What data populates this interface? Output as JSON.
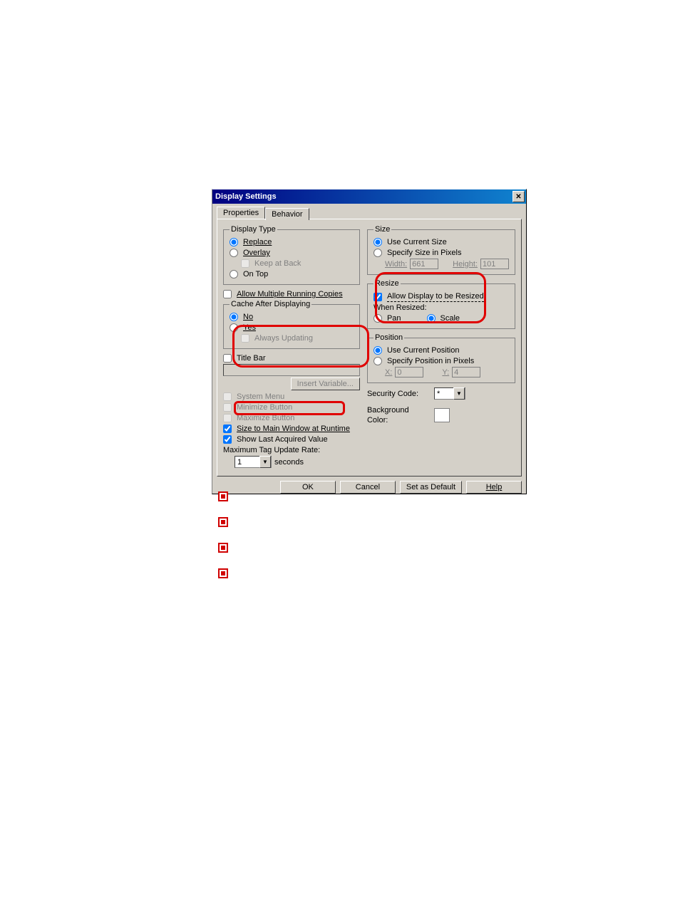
{
  "dialog": {
    "title": "Display Settings",
    "tabs": {
      "properties": "Properties",
      "behavior": "Behavior"
    },
    "left": {
      "display_type": {
        "legend": "Display Type",
        "replace": "Replace",
        "overlay": "Overlay",
        "keep_at_back": "Keep at Back",
        "on_top": "On Top"
      },
      "allow_multiple": "Allow Multiple Running Copies",
      "cache": {
        "legend": "Cache After Displaying",
        "no": "No",
        "yes": "Yes",
        "always_updating": "Always Updating"
      },
      "titlebar": {
        "label": "Title Bar",
        "value": "",
        "insert_variable": "Insert Variable..."
      },
      "system_menu": "System Menu",
      "minimize_button": "Minimize Button",
      "maximize_button": "Maximize Button",
      "size_to_main": "Size to Main Window at Runtime",
      "show_last_acquired": "Show Last Acquired Value",
      "max_tag_update": "Maximum Tag Update Rate:",
      "rate_value": "1",
      "rate_unit": "seconds"
    },
    "right": {
      "size": {
        "legend": "Size",
        "use_current": "Use Current Size",
        "specify": "Specify Size in Pixels",
        "width_label": "Width:",
        "width_value": "661",
        "height_label": "Height:",
        "height_value": "101"
      },
      "resize": {
        "legend": "Resize",
        "allow": "Allow Display to be Resized",
        "when": "When Resized:",
        "pan": "Pan",
        "scale": "Scale"
      },
      "position": {
        "legend": "Position",
        "use_current": "Use Current Position",
        "specify": "Specify Position in Pixels",
        "x_label": "X:",
        "x_value": "0",
        "y_label": "Y:",
        "y_value": "4"
      },
      "security_code": {
        "label": "Security Code:",
        "value": "*"
      },
      "background_color": "Background Color:"
    },
    "buttons": {
      "ok": "OK",
      "cancel": "Cancel",
      "set_default": "Set as Default",
      "help": "Help"
    }
  }
}
